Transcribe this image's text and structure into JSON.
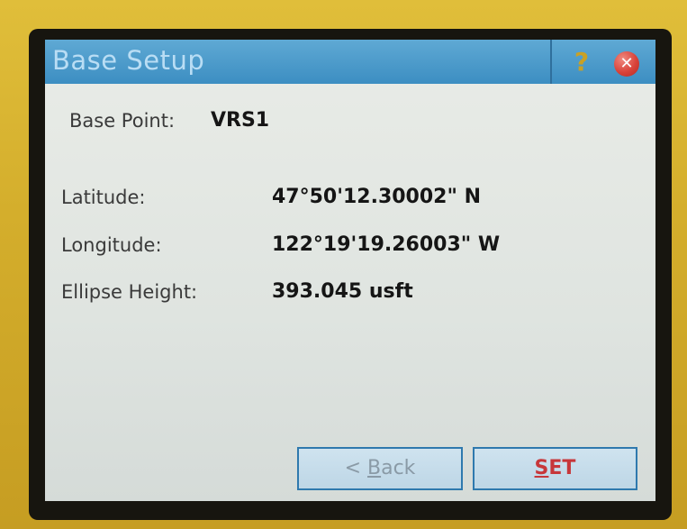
{
  "window": {
    "title": "Base Setup",
    "help_icon": "question-mark-icon",
    "close_icon": "close-icon",
    "close_glyph": "✕"
  },
  "base_point": {
    "label": "Base Point:",
    "value": "VRS1"
  },
  "fields": {
    "latitude": {
      "label": "Latitude:",
      "value": "47°50'12.30002\" N"
    },
    "longitude": {
      "label": "Longitude:",
      "value": "122°19'19.26003\" W"
    },
    "ellipse_height": {
      "label": "Ellipse Height:",
      "value": "393.045 usft"
    }
  },
  "buttons": {
    "back": {
      "prefix": "< ",
      "underlined": "B",
      "rest": "ack"
    },
    "set": {
      "underlined": "S",
      "rest": "ET"
    }
  },
  "colors": {
    "titlebar": "#3c8ec2",
    "set_text": "#c7373a",
    "device_body": "#d4ae2c"
  }
}
